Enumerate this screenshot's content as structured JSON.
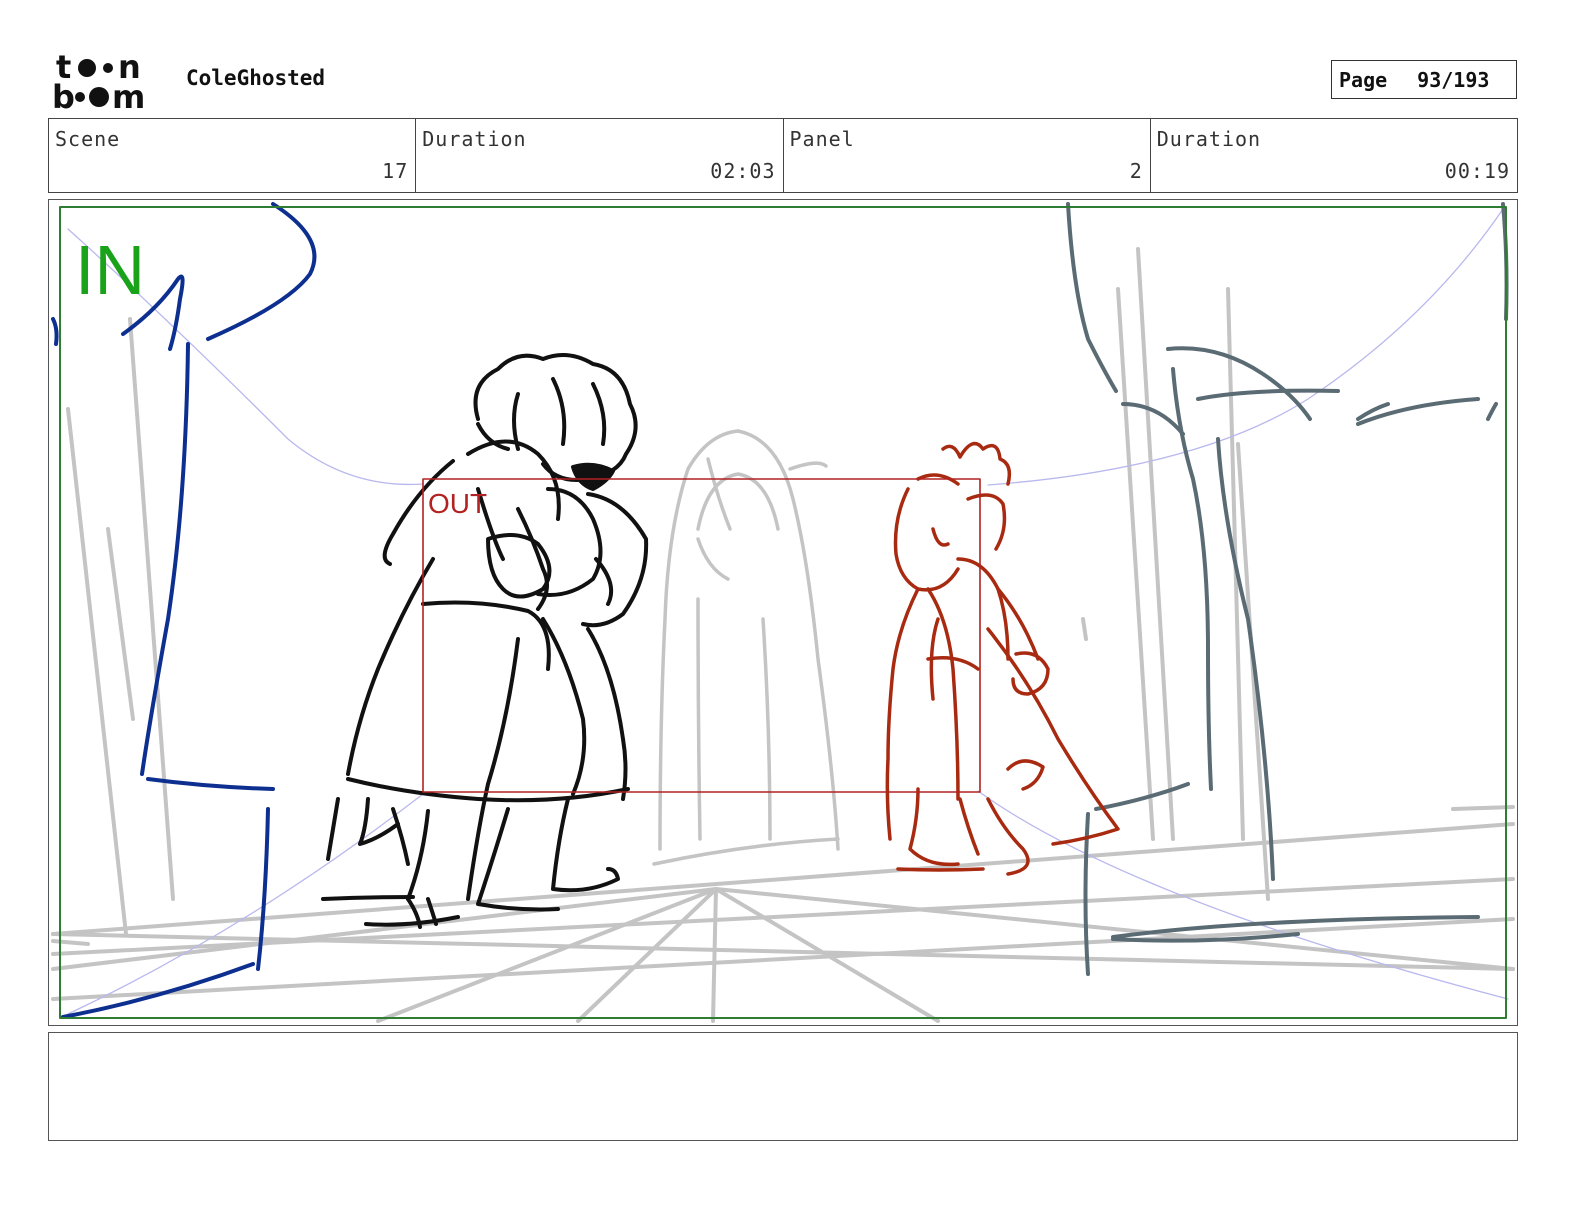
{
  "header": {
    "logo_text": "toon boom",
    "project_title": "ColeGhosted",
    "page_label": "Page",
    "page_number": "93/193"
  },
  "info": {
    "scene_label": "Scene",
    "scene_value": "17",
    "scene_duration_label": "Duration",
    "scene_duration_value": "02:03",
    "panel_label": "Panel",
    "panel_value": "2",
    "panel_duration_label": "Duration",
    "panel_duration_value": "00:19"
  },
  "panel": {
    "in_label": "IN",
    "out_label": "OUT",
    "colors": {
      "in_frame": "#2e7d32",
      "in_text": "#1aa31a",
      "out_frame": "#b22222",
      "blue_layer": "#0d2f8f",
      "grey_layer": "#5a6b74",
      "red_character": "#a82a10",
      "perspective_lines": "#c4c4c4",
      "camera_path": "#b8b8ee"
    }
  },
  "notes": {
    "text": ""
  }
}
